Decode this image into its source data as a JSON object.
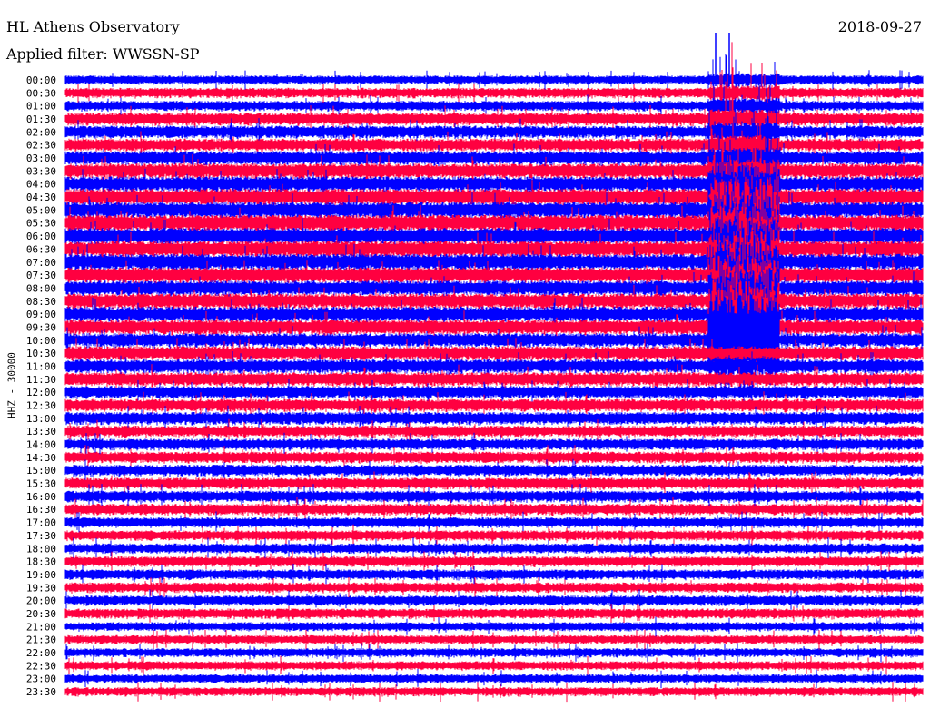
{
  "header": {
    "title": "HL Athens Observatory",
    "date": "2018-09-27",
    "filter": "Applied filter: WWSSN-SP"
  },
  "chart_data": {
    "type": "line",
    "title": "HL Athens Observatory",
    "subtitle": "Applied filter: WWSSN-SP",
    "date": "2018-09-27",
    "ylabel": "HHZ - 30000",
    "minutes_per_row": 30,
    "colors": [
      "#0000ff",
      "#ff0040"
    ],
    "rows": [
      "00:00",
      "00:30",
      "01:00",
      "01:30",
      "02:00",
      "02:30",
      "03:00",
      "03:30",
      "04:00",
      "04:30",
      "05:00",
      "05:30",
      "06:00",
      "06:30",
      "07:00",
      "07:30",
      "08:00",
      "08:30",
      "09:00",
      "09:30",
      "10:00",
      "10:30",
      "11:00",
      "11:30",
      "12:00",
      "12:30",
      "13:00",
      "13:30",
      "14:00",
      "14:30",
      "15:00",
      "15:30",
      "16:00",
      "16:30",
      "17:00",
      "17:30",
      "18:00",
      "18:30",
      "19:00",
      "19:30",
      "20:00",
      "20:30",
      "21:00",
      "21:30",
      "22:00",
      "22:30",
      "23:00",
      "23:30"
    ],
    "noise_level": [
      0.7,
      0.8,
      0.8,
      1.0,
      1.0,
      1.0,
      1.1,
      1.2,
      1.2,
      1.3,
      1.3,
      1.3,
      1.3,
      1.3,
      1.3,
      1.2,
      1.2,
      1.2,
      1.2,
      1.2,
      1.1,
      1.1,
      1.1,
      1.1,
      1.0,
      1.0,
      1.0,
      0.9,
      0.9,
      0.9,
      0.9,
      0.9,
      0.9,
      0.9,
      0.8,
      0.8,
      0.8,
      0.8,
      0.8,
      0.8,
      0.8,
      0.8,
      0.7,
      0.7,
      0.7,
      0.7,
      0.7,
      0.7
    ],
    "event": {
      "first_row": "00:00",
      "peak_rows": [
        "05:00",
        "10:00"
      ],
      "minute_start": 22.5,
      "minute_end": 25,
      "peak_amplitude": 6
    }
  }
}
